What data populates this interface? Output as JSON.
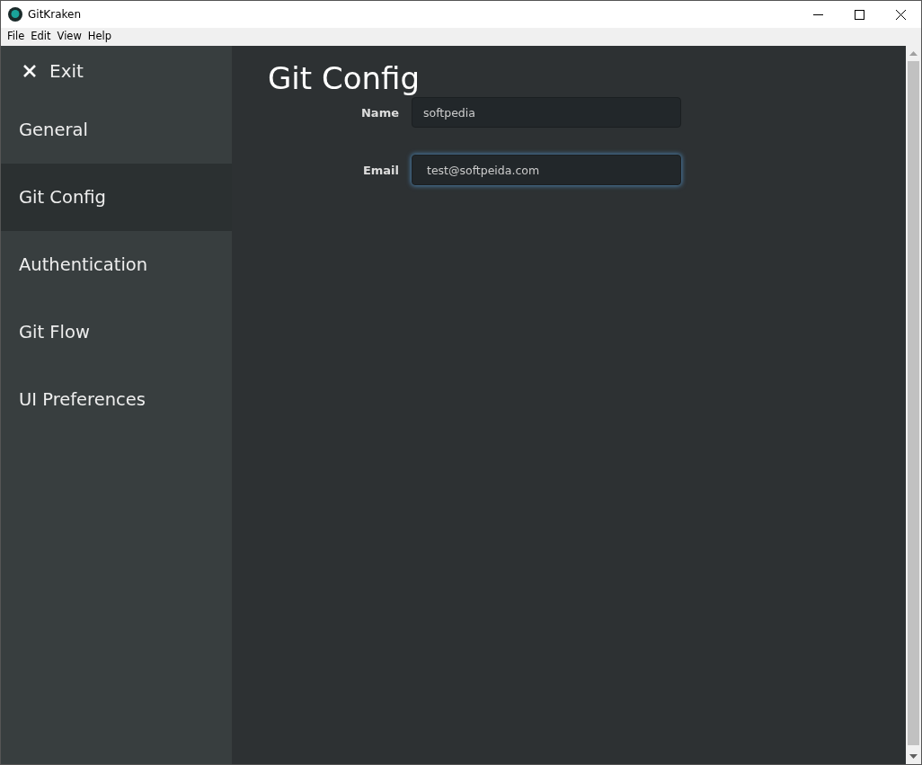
{
  "window": {
    "title": "GitKraken"
  },
  "menu": [
    "File",
    "Edit",
    "View",
    "Help"
  ],
  "sidebar": {
    "exit_label": "Exit",
    "items": [
      {
        "label": "General",
        "selected": false
      },
      {
        "label": "Git Config",
        "selected": true
      },
      {
        "label": "Authentication",
        "selected": false
      },
      {
        "label": "Git Flow",
        "selected": false
      },
      {
        "label": "UI Preferences",
        "selected": false
      }
    ]
  },
  "page_title": "Git Config",
  "fields": [
    {
      "label": "Name",
      "value": "softpedia",
      "focused": false
    },
    {
      "label": "Email",
      "value": "test@softpeida.com",
      "focused": true
    }
  ]
}
